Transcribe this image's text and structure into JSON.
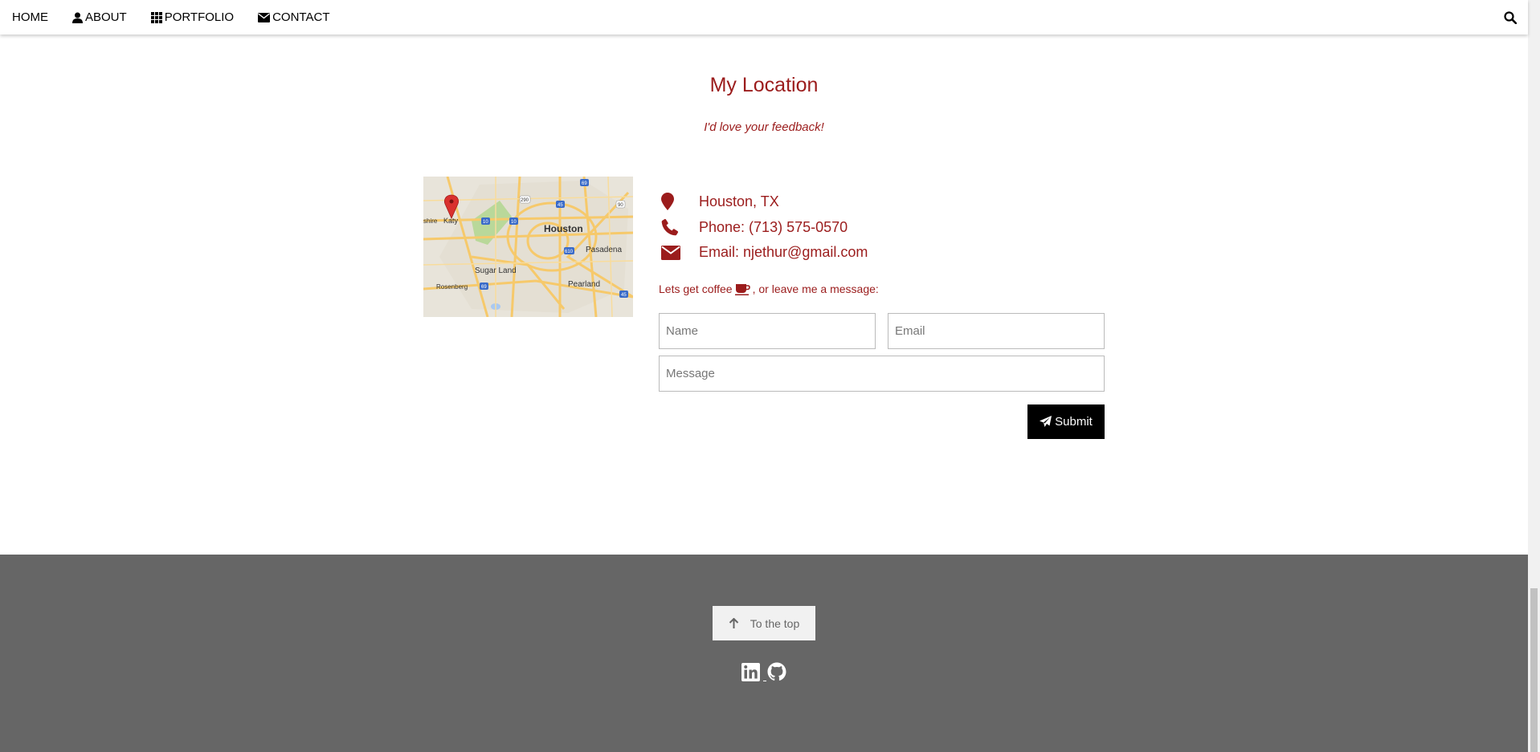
{
  "nav": {
    "home": "HOME",
    "about": "ABOUT",
    "portfolio": "PORTFOLIO",
    "contact": "CONTACT"
  },
  "section": {
    "title": "My Location",
    "subtitle": "I'd love your feedback!"
  },
  "map": {
    "labels": [
      "Houston",
      "Katy",
      "Sugar Land",
      "Pasadena",
      "Pearland",
      "Rosenberg",
      "shire"
    ]
  },
  "contact": {
    "location": "Houston, TX",
    "phone": "Phone: (713) 575-0570",
    "email": "Email: njethur@gmail.com"
  },
  "form": {
    "coffee_prefix": "Lets get coffee",
    "coffee_suffix": ", or leave me a message:",
    "name_placeholder": "Name",
    "email_placeholder": "Email",
    "message_placeholder": "Message",
    "submit_label": "Submit"
  },
  "footer": {
    "to_top_label": "To the top"
  },
  "colors": {
    "accent": "#9b1c1c",
    "footer_bg": "#666666"
  }
}
